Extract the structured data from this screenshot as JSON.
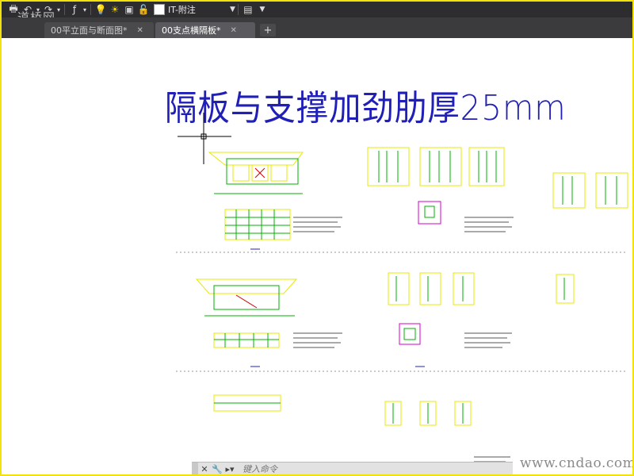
{
  "toolbar": {
    "layer_name": "IT-附注",
    "watermark": "道桥网"
  },
  "tabs": [
    {
      "label": "00平立面与断面图*",
      "close": "✕"
    },
    {
      "label": "00支点横隔板*",
      "close": "✕"
    }
  ],
  "new_tab": "+",
  "drawing": {
    "title": "隔板与支撑加劲肋厚25mm"
  },
  "command": {
    "placeholder": "键入命令"
  },
  "site_watermark": "www.cndao.com",
  "colors": {
    "title": "#2020b8",
    "drawing_yellow": "#e8e800",
    "drawing_green": "#00b000",
    "drawing_magenta": "#d000d0",
    "frame": "#f2e20a"
  }
}
